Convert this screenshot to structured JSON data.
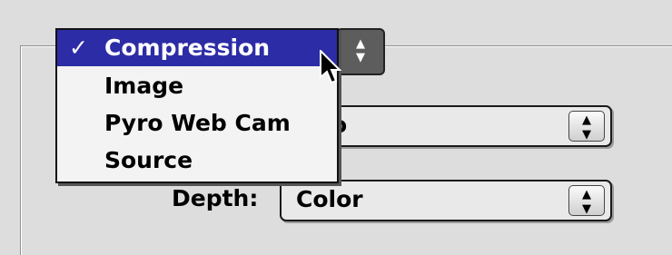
{
  "menu": {
    "selected_check": "✓",
    "items": [
      "Compression",
      "Image",
      "Pyro Web Cam",
      "Source"
    ]
  },
  "format_popup": {
    "visible_value": "eo"
  },
  "depth": {
    "label": "Depth:",
    "value": "Color"
  },
  "icons": {
    "popup_arrows": "up-down-arrows-icon",
    "cursor": "arrow-cursor-icon"
  },
  "colors": {
    "selection": "#2c2ca6",
    "menu_background": "#f3f3f3",
    "window_background": "#dddddd"
  }
}
